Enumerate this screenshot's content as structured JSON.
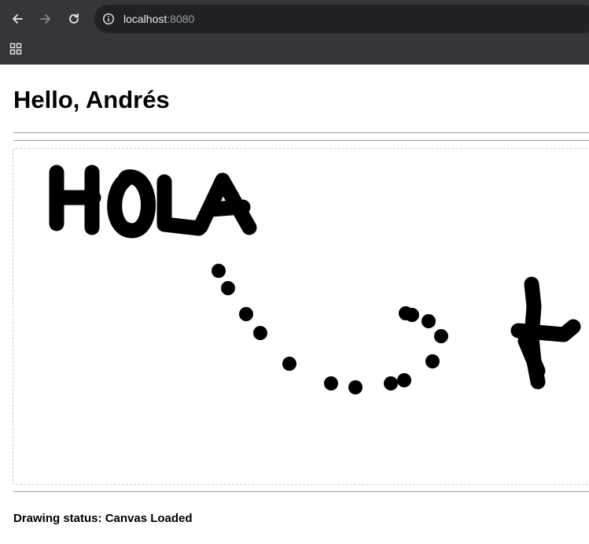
{
  "browser": {
    "url_host": "localhost",
    "url_port": ":8080",
    "icons": {
      "back": "back-arrow-icon",
      "forward": "forward-arrow-icon",
      "reload": "reload-icon",
      "site_info": "info-icon",
      "apps": "apps-grid-icon"
    },
    "colors": {
      "chrome_bg": "#35363a",
      "omnibox_bg": "#202124",
      "url_text": "#e8eaed",
      "url_port_text": "#9aa0a6"
    }
  },
  "page": {
    "title": "Hello, Andrés",
    "status_label": "Drawing status:",
    "status_value": "Canvas Loaded"
  },
  "canvas": {
    "ink_color": "#000000",
    "strokes": [
      "hola-text",
      "dotted-curve",
      "plus-sign"
    ]
  }
}
